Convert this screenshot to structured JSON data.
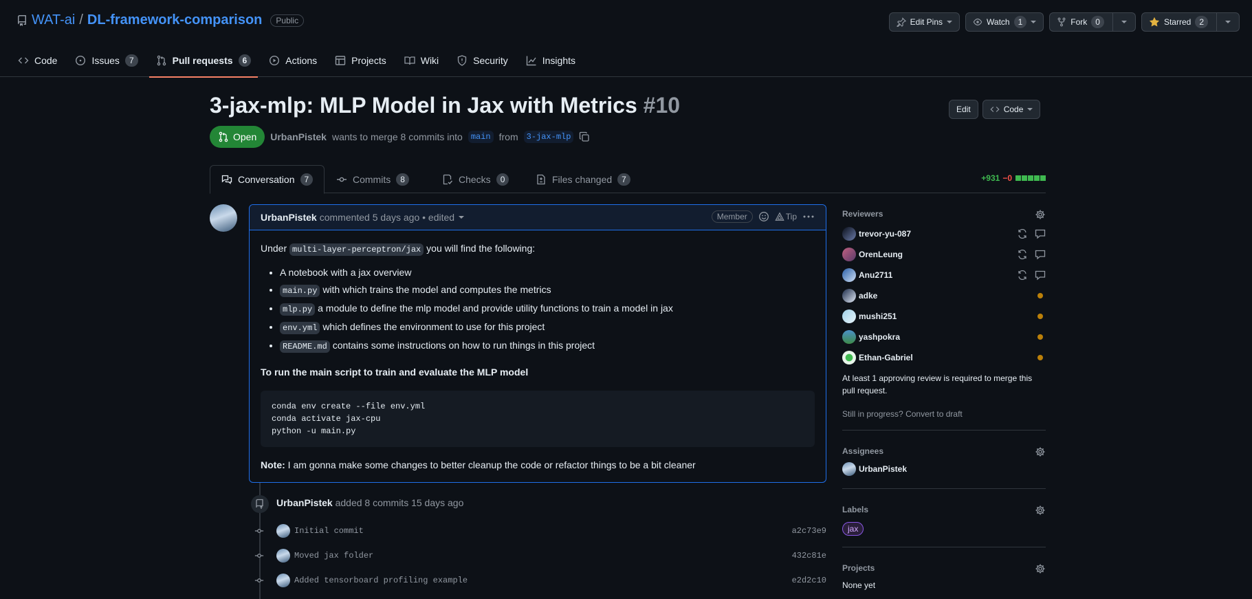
{
  "repo": {
    "owner": "WAT-ai",
    "separator": "/",
    "name": "DL-framework-comparison",
    "visibility": "Public"
  },
  "repo_actions": {
    "edit_pins": "Edit Pins",
    "watch": "Watch",
    "watch_count": "1",
    "fork": "Fork",
    "fork_count": "0",
    "starred": "Starred",
    "star_count": "2"
  },
  "nav": [
    {
      "label": "Code",
      "icon": "code-icon"
    },
    {
      "label": "Issues",
      "count": "7",
      "icon": "issue-icon"
    },
    {
      "label": "Pull requests",
      "count": "6",
      "icon": "pull-request-icon",
      "selected": true
    },
    {
      "label": "Actions",
      "icon": "play-icon"
    },
    {
      "label": "Projects",
      "icon": "table-icon"
    },
    {
      "label": "Wiki",
      "icon": "book-icon"
    },
    {
      "label": "Security",
      "icon": "shield-icon"
    },
    {
      "label": "Insights",
      "icon": "graph-icon"
    }
  ],
  "pr": {
    "title": "3-jax-mlp: MLP Model in Jax with Metrics",
    "number": "#10",
    "edit_label": "Edit",
    "code_label": "Code",
    "state": "Open",
    "author": "UrbanPistek",
    "merge_text": "wants to merge 8 commits into",
    "base_branch": "main",
    "from_text": "from",
    "head_branch": "3-jax-mlp"
  },
  "tabs": [
    {
      "label": "Conversation",
      "count": "7"
    },
    {
      "label": "Commits",
      "count": "8"
    },
    {
      "label": "Checks",
      "count": "0"
    },
    {
      "label": "Files changed",
      "count": "7"
    }
  ],
  "diffstat": {
    "additions": "+931",
    "deletions": "−0"
  },
  "comment": {
    "author": "UrbanPistek",
    "meta": "commented 5 days ago • edited",
    "role": "Member",
    "tip": "Tip",
    "intro_before": "Under",
    "intro_code": "multi-layer-perceptron/jax",
    "intro_after": "you will find the following:",
    "items": [
      {
        "code": "",
        "text": "A notebook with a jax overview"
      },
      {
        "code": "main.py",
        "text": "with which trains the model and computes the metrics"
      },
      {
        "code": "mlp.py",
        "text": "a module to define the mlp model and provide utility functions to train a model in jax"
      },
      {
        "code": "env.yml",
        "text": "which defines the environment to use for this project"
      },
      {
        "code": "README.md",
        "text": "contains some instructions on how to run things in this project"
      }
    ],
    "heading": "To run the main script to train and evaluate the MLP model",
    "code_lines": "conda env create --file env.yml\nconda activate jax-cpu\npython -u main.py",
    "note_label": "Note:",
    "note_text": "I am gonna make some changes to better cleanup the code or refactor things to be a bit cleaner"
  },
  "timeline": {
    "author": "UrbanPistek",
    "text": "added 8 commits 15 days ago",
    "commits": [
      {
        "message": "Initial commit",
        "sha": "a2c73e9"
      },
      {
        "message": "Moved jax folder",
        "sha": "432c81e"
      },
      {
        "message": "Added tensorboard profiling example",
        "sha": "e2d2c10"
      }
    ]
  },
  "sidebar": {
    "reviewers_heading": "Reviewers",
    "reviewers": [
      {
        "name": "trevor-yu-087",
        "status": "commented"
      },
      {
        "name": "OrenLeung",
        "status": "commented"
      },
      {
        "name": "Anu2711",
        "status": "commented"
      },
      {
        "name": "adke",
        "status": "pending"
      },
      {
        "name": "mushi251",
        "status": "pending"
      },
      {
        "name": "yashpokra",
        "status": "pending"
      },
      {
        "name": "Ethan-Gabriel",
        "status": "pending"
      }
    ],
    "review_required": "At least 1 approving review is required to merge this pull request.",
    "still_in_progress": "Still in progress?",
    "convert_to_draft": "Convert to draft",
    "assignees_heading": "Assignees",
    "assignee": "UrbanPistek",
    "labels_heading": "Labels",
    "label": "jax",
    "projects_heading": "Projects",
    "projects_value": "None yet"
  },
  "colors": {
    "accent": "#4493f8",
    "open": "#238636",
    "tab_underline": "#f78166",
    "additions": "#3fb950",
    "deletions": "#f85149",
    "pending": "#bb8009"
  }
}
